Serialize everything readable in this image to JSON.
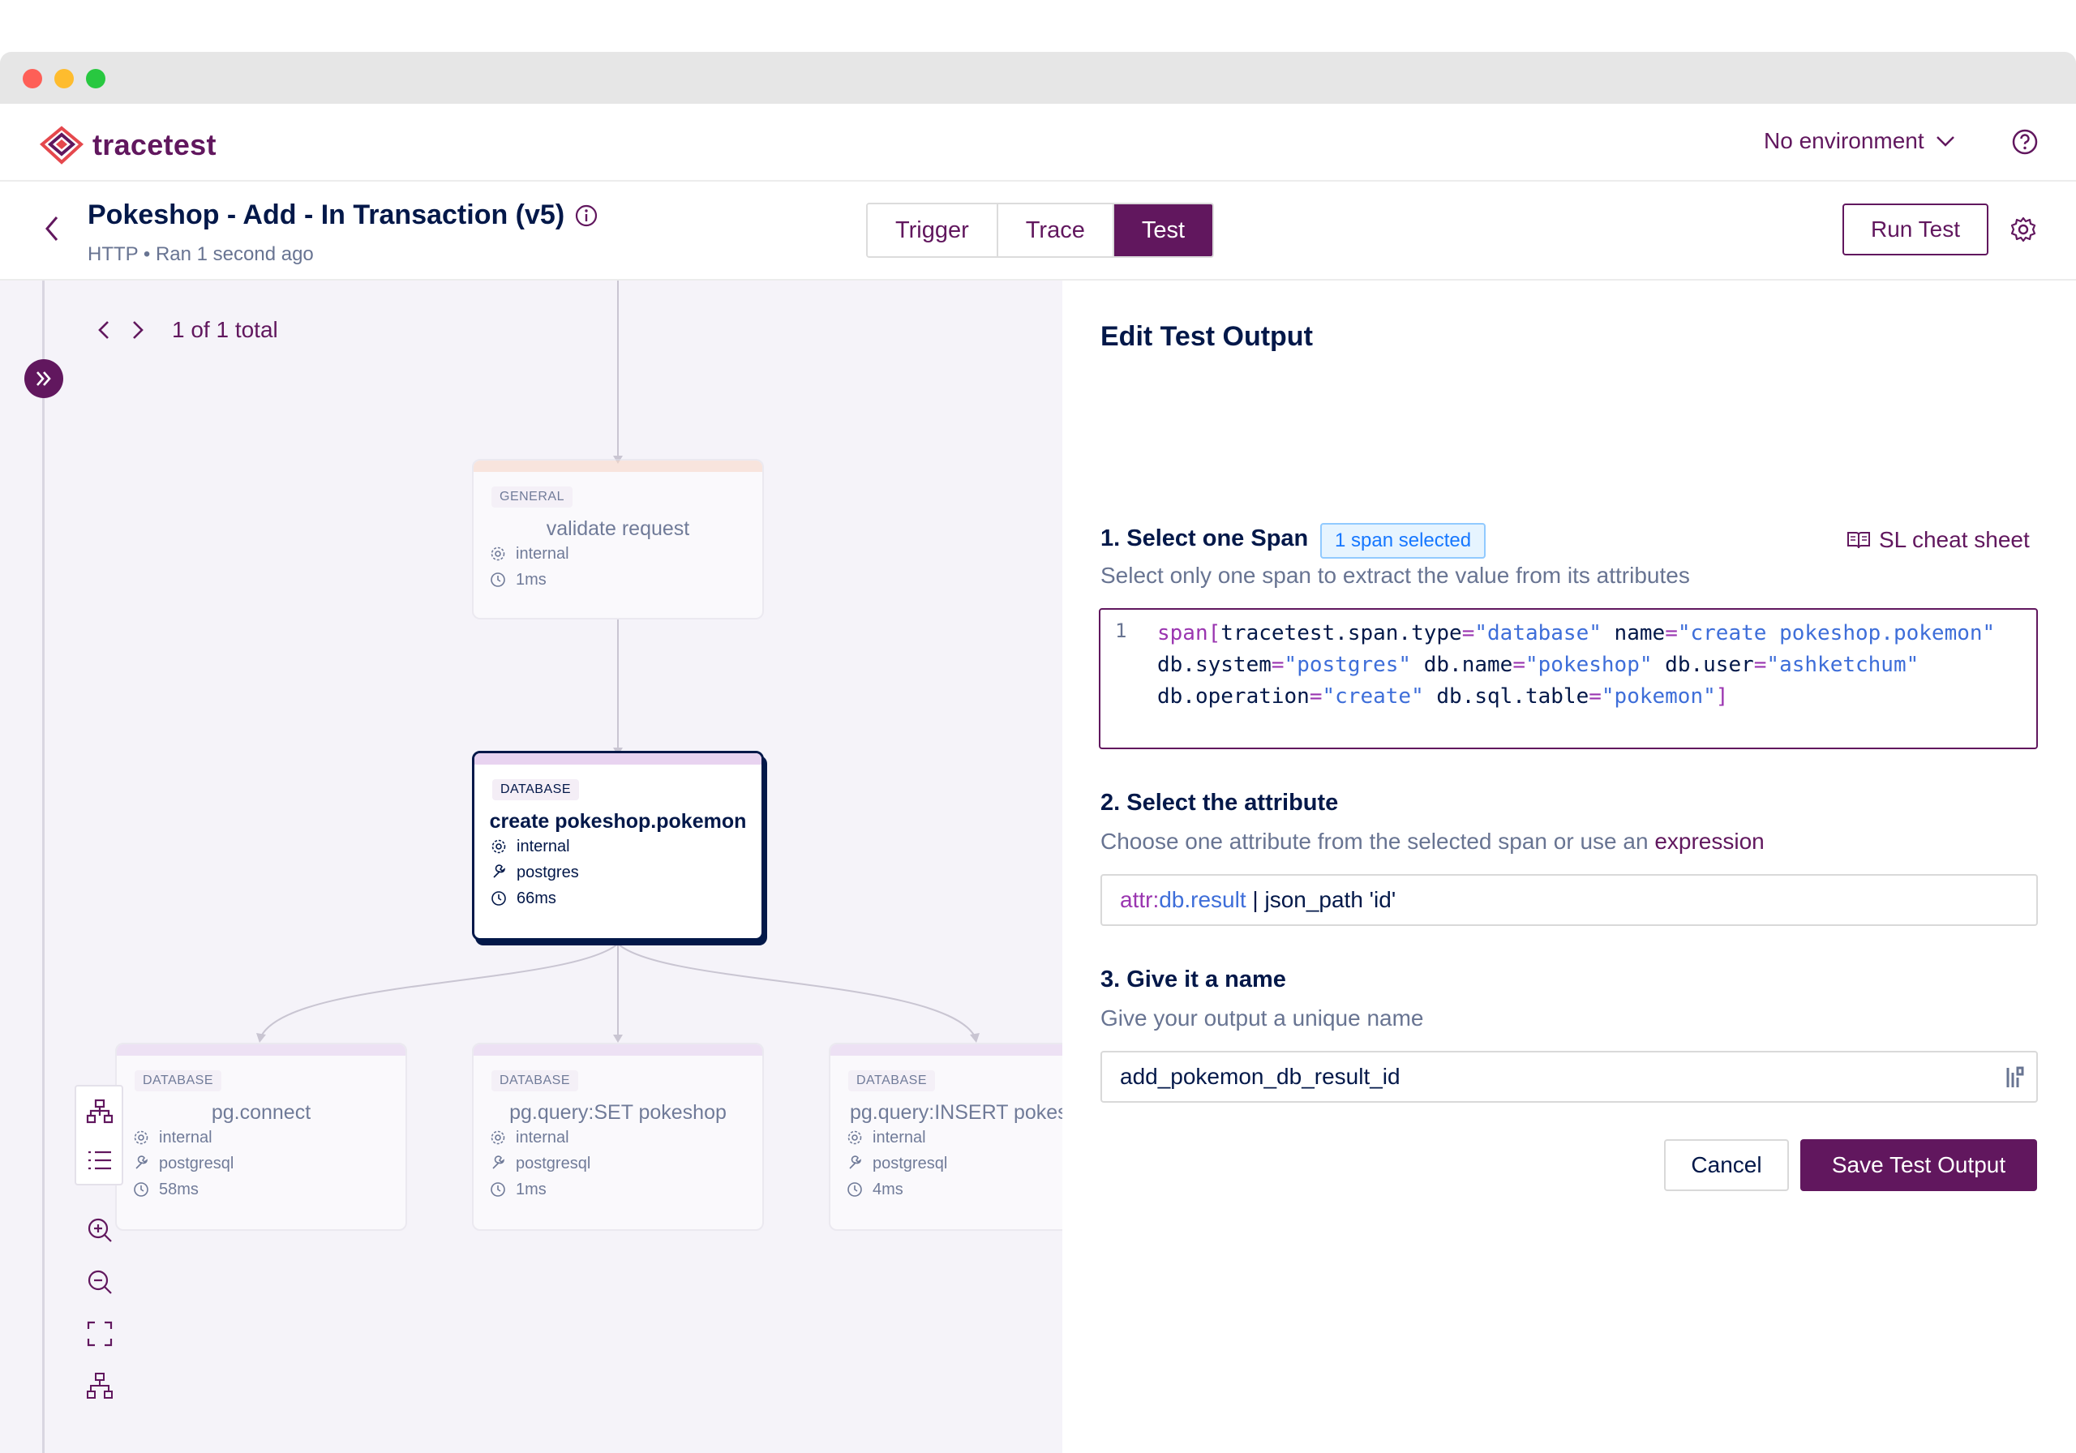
{
  "app": {
    "logo_text": "tracetest"
  },
  "header": {
    "environment_label": "No environment",
    "help_icon": "question-circle-icon"
  },
  "test": {
    "title": "Pokeshop - Add - In Transaction (v5)",
    "meta": "HTTP • Ran 1 second ago",
    "tabs": [
      "Trigger",
      "Trace",
      "Test"
    ],
    "active_tab": "Test",
    "run_button": "Run Test"
  },
  "canvas": {
    "pager_text": "1 of 1 total",
    "nodes": [
      {
        "type": "GENERAL",
        "name": "validate request",
        "rows": [
          "internal",
          "1ms"
        ],
        "accent": "#fbd9c7"
      },
      {
        "type": "DATABASE",
        "name": "create pokeshop.pokemon",
        "rows": [
          "internal",
          "postgres",
          "66ms"
        ],
        "accent": "#e8d3f0",
        "selected": true
      },
      {
        "type": "DATABASE",
        "name": "pg.connect",
        "rows": [
          "internal",
          "postgresql",
          "58ms"
        ],
        "accent": "#e8d3f0"
      },
      {
        "type": "DATABASE",
        "name": "pg.query:SET pokeshop",
        "rows": [
          "internal",
          "postgresql",
          "1ms"
        ],
        "accent": "#e8d3f0"
      },
      {
        "type": "DATABASE",
        "name": "pg.query:INSERT pokes",
        "rows": [
          "internal",
          "postgresql",
          "4ms"
        ],
        "accent": "#e8d3f0"
      }
    ]
  },
  "panel": {
    "title": "Edit Test Output",
    "step1": {
      "title": "1. Select one Span",
      "badge": "1 span selected",
      "cheat_sheet": "SL cheat sheet",
      "description": "Select only one span to extract the value from its attributes",
      "line_number": "1"
    },
    "step2": {
      "title": "2. Select the attribute",
      "description": "Choose one attribute from the selected span or use an",
      "link": "expression",
      "attr_prefix": "attr:",
      "attr_name": "db.result",
      "attr_rest": " | json_path 'id'"
    },
    "step3": {
      "title": "3. Give it a name",
      "description": "Give your output a unique name",
      "value": "add_pokemon_db_result_id"
    },
    "buttons": {
      "cancel": "Cancel",
      "save": "Save Test Output"
    }
  },
  "colors": {
    "brand": "#61175e",
    "text": "#031849",
    "muted": "#687492",
    "link_blue": "#3e6ed9",
    "keyword": "#9a35b0"
  }
}
